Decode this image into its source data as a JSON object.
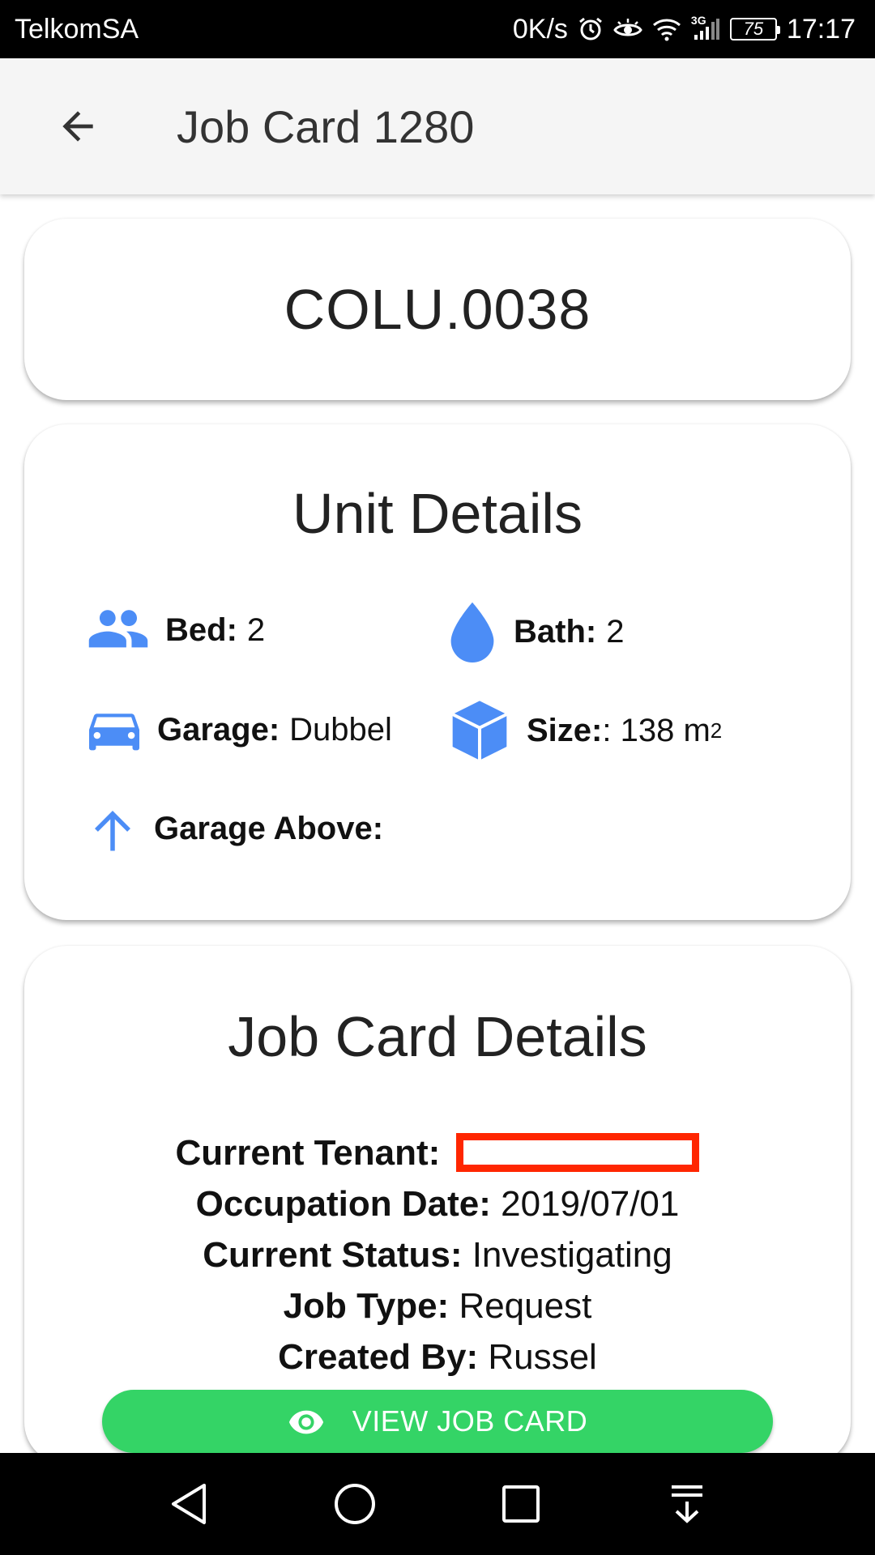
{
  "status_bar": {
    "carrier": "TelkomSA",
    "net_speed": "0K/s",
    "network_type": "3G",
    "battery": "75",
    "time": "17:17",
    "icons": [
      "alarm-icon",
      "eye-comfort-icon",
      "wifi-icon",
      "signal-icon",
      "battery-icon"
    ]
  },
  "app_bar": {
    "title": "Job Card 1280",
    "back_icon": "arrow-back-icon"
  },
  "unit_code": "COLU.0038",
  "unit_details": {
    "heading": "Unit Details",
    "accent_color": "#4c8df6",
    "bed": {
      "label": "Bed:",
      "value": "2",
      "icon": "people-icon"
    },
    "bath": {
      "label": "Bath:",
      "value": "2",
      "icon": "water-drop-icon"
    },
    "garage": {
      "label": "Garage:",
      "value": "Dubbel",
      "icon": "car-icon"
    },
    "size": {
      "label": "Size:",
      "value": ": 138 m",
      "unit_sup": "2",
      "icon": "cube-icon"
    },
    "garage_above": {
      "label": "Garage Above:",
      "value": "",
      "icon": "arrow-up-icon"
    }
  },
  "job_card_details": {
    "heading": "Job Card Details",
    "current_tenant": {
      "label": "Current Tenant:",
      "value": ""
    },
    "occupation_date": {
      "label": "Occupation Date:",
      "value": "2019/07/01"
    },
    "current_status": {
      "label": "Current Status:",
      "value": "Investigating"
    },
    "job_type": {
      "label": "Job Type:",
      "value": "Request"
    },
    "created_by": {
      "label": "Created By:",
      "value": "Russel"
    }
  },
  "view_button": {
    "label": "VIEW JOB CARD",
    "icon": "eye-icon",
    "color": "#34d466"
  },
  "nav_bar": {
    "items": [
      "back-triangle-icon",
      "home-circle-icon",
      "recents-square-icon",
      "notification-pulldown-icon"
    ]
  },
  "redaction_color": "#ff2600"
}
